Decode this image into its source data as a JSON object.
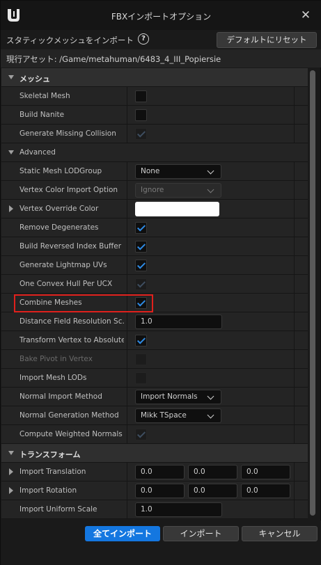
{
  "window": {
    "title": "FBXインポートオプション",
    "close_symbol": "✕"
  },
  "subheader": {
    "label": "スタティックメッシュをインポート",
    "help_symbol": "?",
    "reset_label": "デフォルトにリセット"
  },
  "asset": {
    "text": "現行アセット:  /Game/metahuman/6483_4_III_Popiersie"
  },
  "mesh": {
    "category_label": "メッシュ",
    "skeletal_mesh": "Skeletal Mesh",
    "build_nanite": "Build Nanite",
    "generate_missing_collision": "Generate Missing Collision",
    "advanced_label": "Advanced",
    "static_mesh_lod_group": "Static Mesh LODGroup",
    "lod_group_value": "None",
    "vertex_color_import_option": "Vertex Color Import Option",
    "vertex_color_value": "Ignore",
    "vertex_override_color": "Vertex Override Color",
    "remove_degenerates": "Remove Degenerates",
    "build_reversed_index_buffer": "Build Reversed Index Buffer",
    "generate_lightmap_uvs": "Generate Lightmap UVs",
    "one_convex_hull_per_ucx": "One Convex Hull Per UCX",
    "combine_meshes": "Combine Meshes",
    "distance_field_resolution_scale": "Distance Field Resolution Sc...",
    "distance_field_value": "1.0",
    "transform_vertex_to_absolute": "Transform Vertex to Absolute",
    "bake_pivot_in_vertex": "Bake Pivot in Vertex",
    "import_mesh_lods": "Import Mesh LODs",
    "normal_import_method": "Normal Import Method",
    "normal_import_value": "Import Normals",
    "normal_generation_method": "Normal Generation Method",
    "normal_generation_value": "Mikk TSpace",
    "compute_weighted_normals": "Compute Weighted Normals"
  },
  "transform": {
    "category_label": "トランスフォーム",
    "import_translation": "Import Translation",
    "translation": [
      "0.0",
      "0.0",
      "0.0"
    ],
    "import_rotation": "Import Rotation",
    "rotation": [
      "0.0",
      "0.0",
      "0.0"
    ],
    "import_uniform_scale": "Import Uniform Scale",
    "scale": "1.0"
  },
  "footer": {
    "import_all": "全てインポート",
    "import": "インポート",
    "cancel": "キャンセル"
  },
  "colors": {
    "accent": "#1477e0",
    "checkmark": "#2e8be6",
    "highlight": "#e0201c",
    "override_color": "#ffffff"
  }
}
